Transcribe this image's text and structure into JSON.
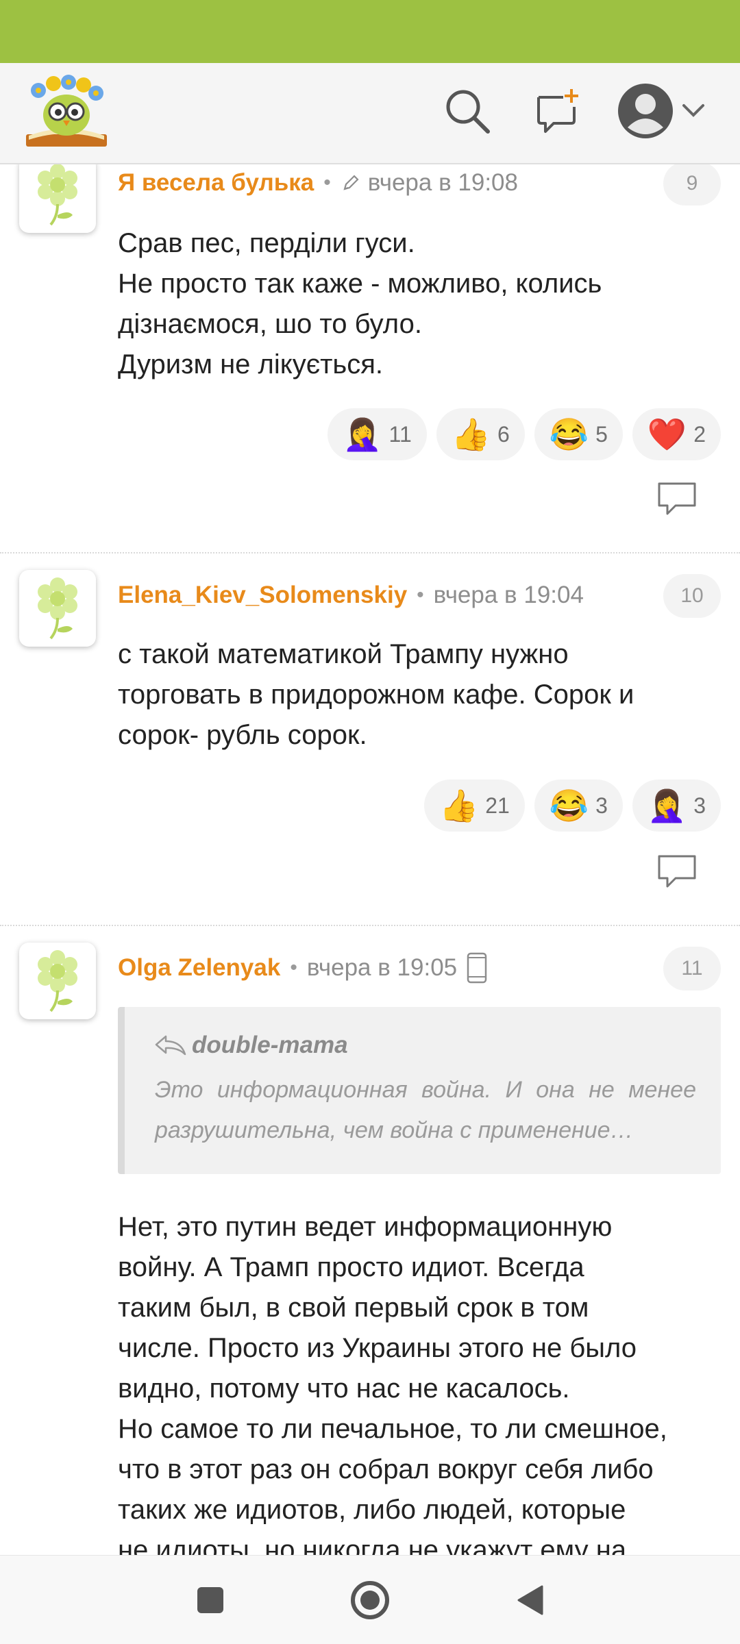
{
  "colors": {
    "statusbar": "#9dc142",
    "author": "#e88a1a",
    "meta": "#8d8d8d"
  },
  "header": {
    "logo_icon": "owl-book-logo",
    "search_icon": "search-icon",
    "new_post_icon": "new-message-icon",
    "profile_icon": "profile-avatar-icon"
  },
  "comments": [
    {
      "author": "Я весела булька",
      "edited_icon": "pencil-icon",
      "time": "вчера в 19:08",
      "number": "9",
      "lines": [
        "Срав пес, перділи гуси.",
        "Не просто так каже - можливо, колись",
        "дізнаємося, шо то було.",
        "Дуризм не лікується."
      ],
      "reactions": [
        {
          "emoji": "🤦‍♀️",
          "count": "11"
        },
        {
          "emoji": "👍",
          "count": "6"
        },
        {
          "emoji": "😂",
          "count": "5"
        },
        {
          "emoji": "❤️",
          "count": "2"
        }
      ]
    },
    {
      "author": "Elena_Kiev_Solomenskiy",
      "time": "вчера в 19:04",
      "number": "10",
      "lines": [
        "с такой математикой Трампу нужно",
        "торговать в придорожном кафе. Сорок и",
        "сорок- рубль сорок."
      ],
      "reactions": [
        {
          "emoji": "👍",
          "count": "21"
        },
        {
          "emoji": "😂",
          "count": "3"
        },
        {
          "emoji": "🤦‍♀️",
          "count": "3"
        }
      ]
    },
    {
      "author": "Olga Zelenyak",
      "time": "вчера в 19:05",
      "device_icon": "mobile-phone-icon",
      "number": "11",
      "quote": {
        "author": "double-mama",
        "text": "Это информационная война. И она не менее разрушительна, чем война с применение…"
      },
      "lines": [
        "Нет, это путин ведет информационную",
        "войну. А Трамп просто идиот. Всегда",
        "таким был, в свой первый срок в том",
        "числе. Просто из Украины этого не было",
        "видно, потому что нас не касалось.",
        "Но самое то ли печальное, то ли смешное,",
        "что в этот раз он собрал вокруг себя либо",
        "таких же идиотов, либо людей, которые",
        "не идиоты, но никогда не укажут ему на"
      ]
    }
  ],
  "navbar": {
    "recents_icon": "square-recents-icon",
    "home_icon": "circle-home-icon",
    "back_icon": "triangle-back-icon"
  }
}
